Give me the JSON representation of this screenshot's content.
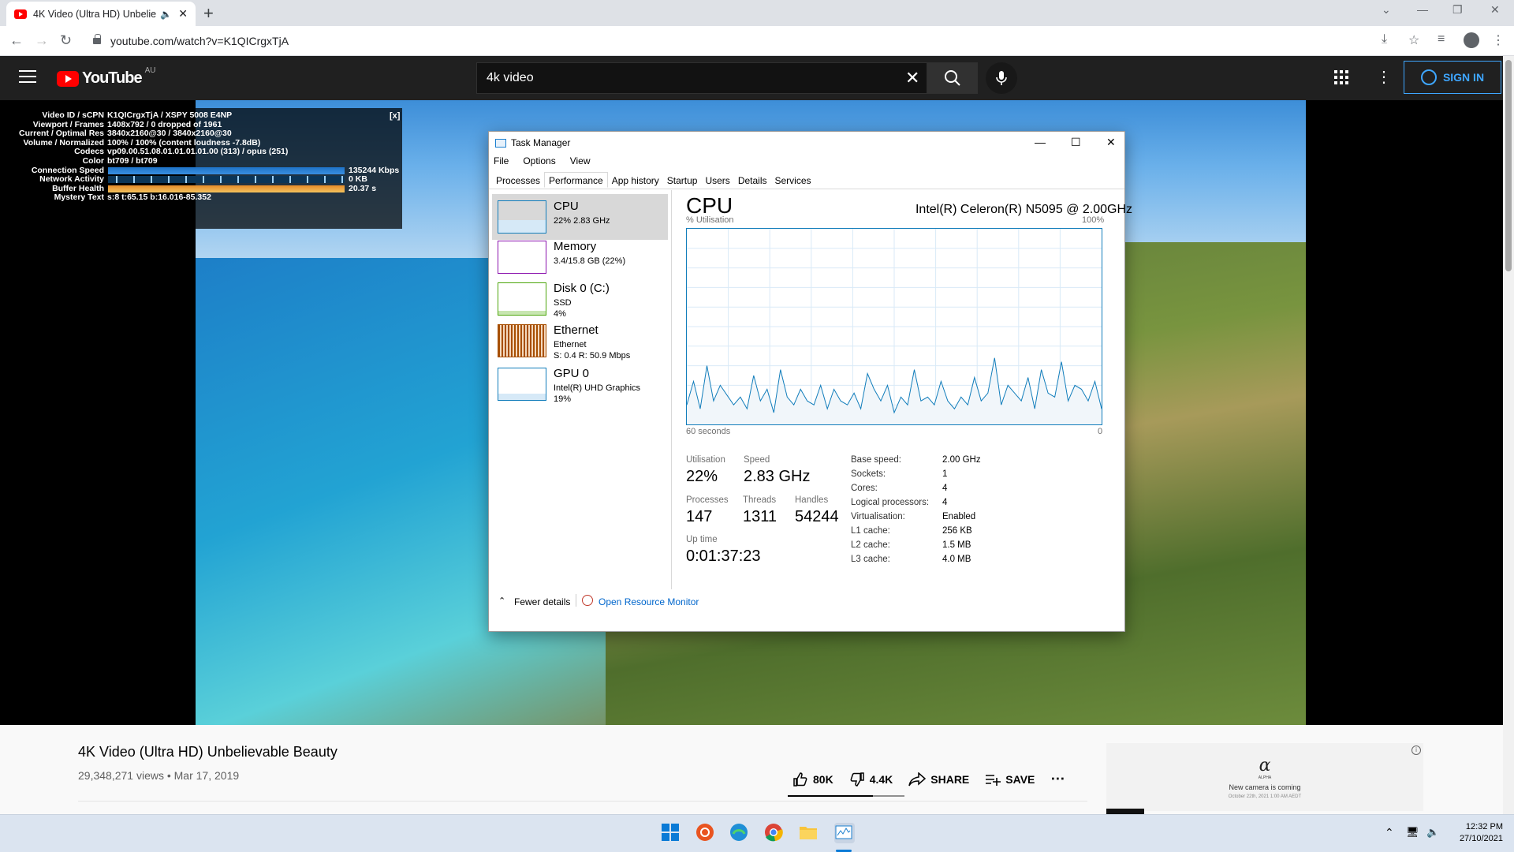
{
  "browser": {
    "tab_title": "4K Video (Ultra HD) Unbelie",
    "url": "youtube.com/watch?v=K1QICrgxTjA"
  },
  "youtube": {
    "logo_text": "YouTube",
    "region": "AU",
    "search_value": "4k video",
    "sign_in": "SIGN IN"
  },
  "stats": {
    "rows": [
      {
        "label": "Video ID / sCPN",
        "value": "K1QICrgxTjA / XSPY 5008 E4NP"
      },
      {
        "label": "Viewport / Frames",
        "value": "1408x792 / 0 dropped of 1961"
      },
      {
        "label": "Current / Optimal Res",
        "value": "3840x2160@30 / 3840x2160@30"
      },
      {
        "label": "Volume / Normalized",
        "value": "100% / 100% (content loudness -7.8dB)"
      },
      {
        "label": "Codecs",
        "value": "vp09.00.51.08.01.01.01.01.00 (313) / opus (251)"
      },
      {
        "label": "Color",
        "value": "bt709 / bt709"
      },
      {
        "label": "Connection Speed",
        "value": "135244 Kbps"
      },
      {
        "label": "Network Activity",
        "value": "0 KB"
      },
      {
        "label": "Buffer Health",
        "value": "20.37 s"
      },
      {
        "label": "Mystery Text",
        "value": "s:8 t:65.15 b:16.016-85.352"
      }
    ],
    "close": "[x]"
  },
  "taskmanager": {
    "title": "Task Manager",
    "menu": [
      "File",
      "Options",
      "View"
    ],
    "tabs": [
      "Processes",
      "Performance",
      "App history",
      "Startup",
      "Users",
      "Details",
      "Services"
    ],
    "active_tab": "Performance",
    "sidebar": [
      {
        "name": "CPU",
        "line1": "22% 2.83 GHz",
        "line2": "",
        "color": "#117dbb"
      },
      {
        "name": "Memory",
        "line1": "3.4/15.8 GB (22%)",
        "line2": "",
        "color": "#8b12ae"
      },
      {
        "name": "Disk 0 (C:)",
        "line1": "SSD",
        "line2": "4%",
        "color": "#4da60c"
      },
      {
        "name": "Ethernet",
        "line1": "Ethernet",
        "line2": "S: 0.4 R: 50.9 Mbps",
        "color": "#a74f01"
      },
      {
        "name": "GPU 0",
        "line1": "Intel(R) UHD Graphics",
        "line2": "19%",
        "color": "#117dbb"
      }
    ],
    "main": {
      "heading": "CPU",
      "cpu_name": "Intel(R) Celeron(R) N5095 @ 2.00GHz",
      "util_label": "% Utilisation",
      "util_max": "100%",
      "time_label": "60 seconds",
      "time_end": "0",
      "stats": [
        {
          "label": "Utilisation",
          "value": "22%"
        },
        {
          "label": "Speed",
          "value": "2.83 GHz"
        },
        {
          "label": "Processes",
          "value": "147"
        },
        {
          "label": "Threads",
          "value": "1311"
        },
        {
          "label": "Handles",
          "value": "54244"
        },
        {
          "label": "Up time",
          "value": "0:01:37:23"
        }
      ],
      "specs": [
        {
          "label": "Base speed:",
          "value": "2.00 GHz"
        },
        {
          "label": "Sockets:",
          "value": "1"
        },
        {
          "label": "Cores:",
          "value": "4"
        },
        {
          "label": "Logical processors:",
          "value": "4"
        },
        {
          "label": "Virtualisation:",
          "value": "Enabled"
        },
        {
          "label": "L1 cache:",
          "value": "256 KB"
        },
        {
          "label": "L2 cache:",
          "value": "1.5 MB"
        },
        {
          "label": "L3 cache:",
          "value": "4.0 MB"
        }
      ]
    },
    "fewer_details": "Fewer details",
    "resource_monitor": "Open Resource Monitor"
  },
  "chart_data": {
    "type": "line",
    "ylim": [
      0,
      100
    ],
    "values": [
      10,
      22,
      8,
      30,
      12,
      20,
      15,
      10,
      14,
      8,
      25,
      12,
      18,
      6,
      28,
      14,
      10,
      18,
      12,
      10,
      20,
      8,
      18,
      12,
      10,
      16,
      8,
      26,
      18,
      12,
      20,
      6,
      14,
      10,
      28,
      12,
      14,
      10,
      22,
      12,
      8,
      14,
      10,
      24,
      12,
      16,
      34,
      10,
      20,
      16,
      12,
      24,
      8,
      28,
      16,
      14,
      32,
      12,
      20,
      18,
      12,
      22,
      8
    ]
  },
  "video": {
    "title": "4K Video (Ultra HD) Unbelievable Beauty",
    "meta": "29,348,271 views • Mar 17, 2019",
    "likes": "80K",
    "dislikes": "4.4K",
    "share": "SHARE",
    "save": "SAVE"
  },
  "ad": {
    "brand": "α",
    "brand_sub": "ALPHA",
    "headline": "New camera is coming",
    "date": "October 22th, 2021 1:00 AM AEDT"
  },
  "taskbar": {
    "time": "12:32 PM",
    "date": "27/10/2021"
  }
}
